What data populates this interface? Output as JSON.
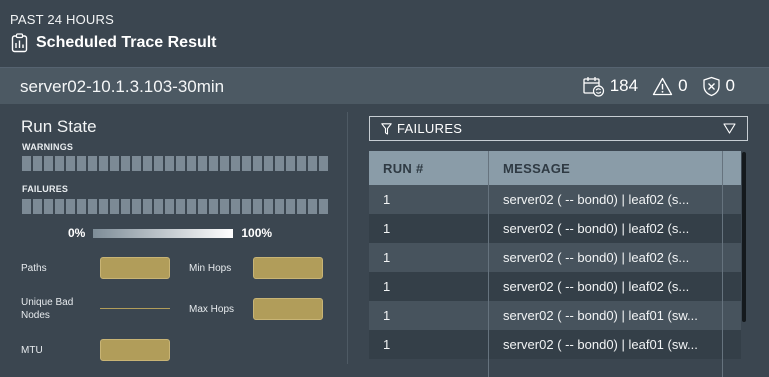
{
  "header": {
    "period": "PAST 24 HOURS",
    "title": "Scheduled Trace Result"
  },
  "trace_bar": {
    "name": "server02-10.1.3.103-30min",
    "stats": [
      {
        "icon": "calendar-refresh-icon",
        "value": "184"
      },
      {
        "icon": "warning-triangle-icon",
        "value": "0"
      },
      {
        "icon": "shield-x-icon",
        "value": "0"
      }
    ]
  },
  "run_state": {
    "title": "Run State",
    "warnings_label": "WARNINGS",
    "failures_label": "FAILURES",
    "legend_min": "0%",
    "legend_max": "100%"
  },
  "metrics": {
    "paths": "Paths",
    "unique_bad_nodes": "Unique Bad Nodes",
    "mtu": "MTU",
    "min_hops": "Min Hops",
    "max_hops": "Max Hops"
  },
  "filter": {
    "selected": "FAILURES"
  },
  "table": {
    "columns": [
      "RUN #",
      "MESSAGE"
    ],
    "rows": [
      {
        "run": "1",
        "message": "server02 ( -- bond0) | leaf02 (s..."
      },
      {
        "run": "1",
        "message": "server02 ( -- bond0) | leaf02 (s..."
      },
      {
        "run": "1",
        "message": "server02 ( -- bond0) | leaf02 (s..."
      },
      {
        "run": "1",
        "message": "server02 ( -- bond0) | leaf02 (s..."
      },
      {
        "run": "1",
        "message": "server02 ( -- bond0) | leaf01 (sw..."
      },
      {
        "run": "1",
        "message": "server02 ( -- bond0) | leaf01 (sw..."
      }
    ]
  },
  "colors": {
    "background": "#3b4650",
    "bar": "#4c5963",
    "header_row": "#8a9ca8",
    "metric_fill": "#b19d5a",
    "grid_cell": "#7c8a95"
  }
}
